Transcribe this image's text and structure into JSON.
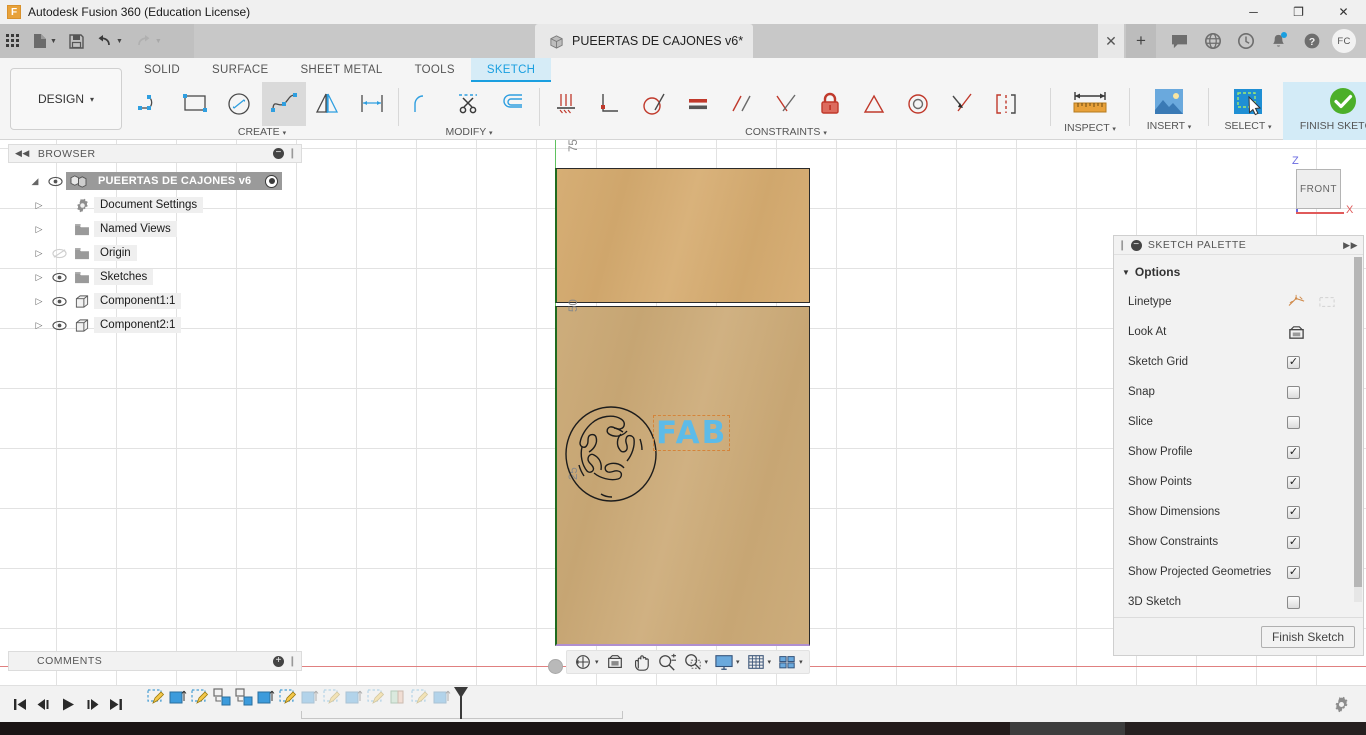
{
  "titlebar": {
    "app_title": "Autodesk Fusion 360 (Education License)",
    "logo_letter": "F",
    "minimize": "─",
    "maximize": "❐",
    "close": "✕"
  },
  "appbar": {
    "grid_icon": "grid-apps-icon",
    "new_icon": "new-document-icon",
    "save_icon": "save-icon",
    "undo_icon": "undo-icon",
    "redo_icon": "redo-icon",
    "caret": "▼",
    "document_tab": "PUEERTAS DE CAJONES v6*",
    "tab_close": "✕",
    "tab_add": "+",
    "icons": [
      "comment-icon",
      "globe-icon",
      "clock-icon",
      "bell-icon",
      "help-icon"
    ],
    "avatar_initials": "FC"
  },
  "ribbon": {
    "design_label": "DESIGN",
    "design_caret": "▾",
    "workspace_tabs": [
      {
        "label": "SOLID",
        "active": false
      },
      {
        "label": "SURFACE",
        "active": false
      },
      {
        "label": "SHEET METAL",
        "active": false
      },
      {
        "label": "TOOLS",
        "active": false
      },
      {
        "label": "SKETCH",
        "active": true
      }
    ],
    "groups": [
      {
        "label": "CREATE",
        "caret": "▾",
        "tools": [
          "line-arc-icon",
          "rectangle-icon",
          "circle-icon",
          "spline-icon",
          "mirror-icon",
          "dimension-icon"
        ]
      },
      {
        "label": "MODIFY",
        "caret": "▾",
        "tools": [
          "fillet-icon",
          "trim-scissors-icon",
          "offset-icon"
        ]
      },
      {
        "label": "CONSTRAINTS",
        "caret": "▾",
        "tools": [
          "horizontal-vertical-icon",
          "perpendicular-icon",
          "tangent-icon",
          "equal-icon",
          "parallel-icon",
          "coincident-icon",
          "fix-lock-icon",
          "midpoint-icon",
          "concentric-icon",
          "collinear-icon",
          "symmetry-icon"
        ]
      }
    ],
    "big_buttons": [
      {
        "label": "INSPECT",
        "caret": "▾",
        "icon": "measure-ruler-icon"
      },
      {
        "label": "INSERT",
        "caret": "▾",
        "icon": "insert-image-icon"
      },
      {
        "label": "SELECT",
        "caret": "▾",
        "icon": "select-cursor-icon"
      },
      {
        "label": "FINISH SKETCH",
        "caret": "▾",
        "icon": "green-check-icon"
      }
    ]
  },
  "browser": {
    "title": "BROWSER",
    "collapse_icon": "◀◀",
    "minimize_icon": "−",
    "grip_icon": "❙",
    "root": {
      "label": "PUEERTAS DE CAJONES v6",
      "twist": "◢",
      "eye": "eye-icon",
      "icon": "assembly-icon"
    },
    "items": [
      {
        "label": "Document Settings",
        "twist": "▷",
        "icon": "gear-icon",
        "eye": false,
        "eye_off": false
      },
      {
        "label": "Named Views",
        "twist": "▷",
        "icon": "folder-icon",
        "eye": false,
        "eye_off": false
      },
      {
        "label": "Origin",
        "twist": "▷",
        "icon": "folder-icon",
        "eye": true,
        "eye_off": true
      },
      {
        "label": "Sketches",
        "twist": "▷",
        "icon": "folder-icon",
        "eye": true,
        "eye_off": false
      },
      {
        "label": "Component1:1",
        "twist": "▷",
        "icon": "component-icon",
        "eye": true,
        "eye_off": false
      },
      {
        "label": "Component2:1",
        "twist": "▷",
        "icon": "component-icon",
        "eye": true,
        "eye_off": false
      }
    ]
  },
  "comments": {
    "title": "COMMENTS",
    "add_icon": "+",
    "grip_icon": "❙"
  },
  "canvas": {
    "dimension_labels": [
      "75",
      "50",
      "25"
    ],
    "sketch_text": "FAB",
    "sketch_text_color": "#5dbbe8",
    "panel_top_color": "#d6ae75",
    "panel_bottom_color": "#cdad7c",
    "logo_name": "fab-lab-logo-sketch",
    "viewcube": {
      "face": "FRONT",
      "axis_z": "Z",
      "axis_x": "X"
    }
  },
  "navbar": {
    "caret": "▾",
    "items": [
      "orbit-icon",
      "look-at-icon",
      "pan-icon",
      "zoom-icon",
      "zoom-window-icon",
      "display-settings-icon",
      "grid-snaps-icon",
      "viewports-icon"
    ]
  },
  "palette": {
    "title": "SKETCH PALETTE",
    "grip_icon": "❙",
    "minimize_icon": "−",
    "expand_icon": "▶▶",
    "section": "Options",
    "section_tri": "▼",
    "rows": [
      {
        "label": "Linetype",
        "control": "linetype-icons",
        "checked": null
      },
      {
        "label": "Look At",
        "control": "look-at-icon",
        "checked": null
      },
      {
        "label": "Sketch Grid",
        "control": "checkbox",
        "checked": true
      },
      {
        "label": "Snap",
        "control": "checkbox",
        "checked": false
      },
      {
        "label": "Slice",
        "control": "checkbox",
        "checked": false
      },
      {
        "label": "Show Profile",
        "control": "checkbox",
        "checked": true
      },
      {
        "label": "Show Points",
        "control": "checkbox",
        "checked": true
      },
      {
        "label": "Show Dimensions",
        "control": "checkbox",
        "checked": true
      },
      {
        "label": "Show Constraints",
        "control": "checkbox",
        "checked": true
      },
      {
        "label": "Show Projected Geometries",
        "control": "checkbox",
        "checked": true
      },
      {
        "label": "3D Sketch",
        "control": "checkbox",
        "checked": false
      }
    ],
    "finish_button": "Finish Sketch",
    "check_glyph": "✓"
  },
  "timeline": {
    "play_buttons": [
      "go-to-start-icon",
      "step-back-icon",
      "play-icon",
      "step-forward-icon",
      "go-to-end-icon"
    ],
    "features": [
      {
        "icon": "sketch-feature-icon",
        "dimmed": false
      },
      {
        "icon": "extrude-feature-icon",
        "dimmed": false
      },
      {
        "icon": "sketch-feature-icon",
        "dimmed": false
      },
      {
        "icon": "joint-feature-icon",
        "dimmed": false
      },
      {
        "icon": "joint-feature-icon",
        "dimmed": false
      },
      {
        "icon": "extrude-feature-icon",
        "dimmed": false
      },
      {
        "icon": "sketch-feature-icon",
        "dimmed": false
      },
      {
        "icon": "extrude-feature-icon",
        "dimmed": true
      },
      {
        "icon": "sketch-feature-icon",
        "dimmed": true
      },
      {
        "icon": "extrude-feature-icon",
        "dimmed": true
      },
      {
        "icon": "sketch-feature-icon",
        "dimmed": true
      },
      {
        "icon": "shell-feature-icon",
        "dimmed": true
      },
      {
        "icon": "sketch-feature-icon",
        "dimmed": true
      },
      {
        "icon": "extrude-feature-icon",
        "dimmed": true
      }
    ],
    "settings_icon": "gear-icon"
  }
}
